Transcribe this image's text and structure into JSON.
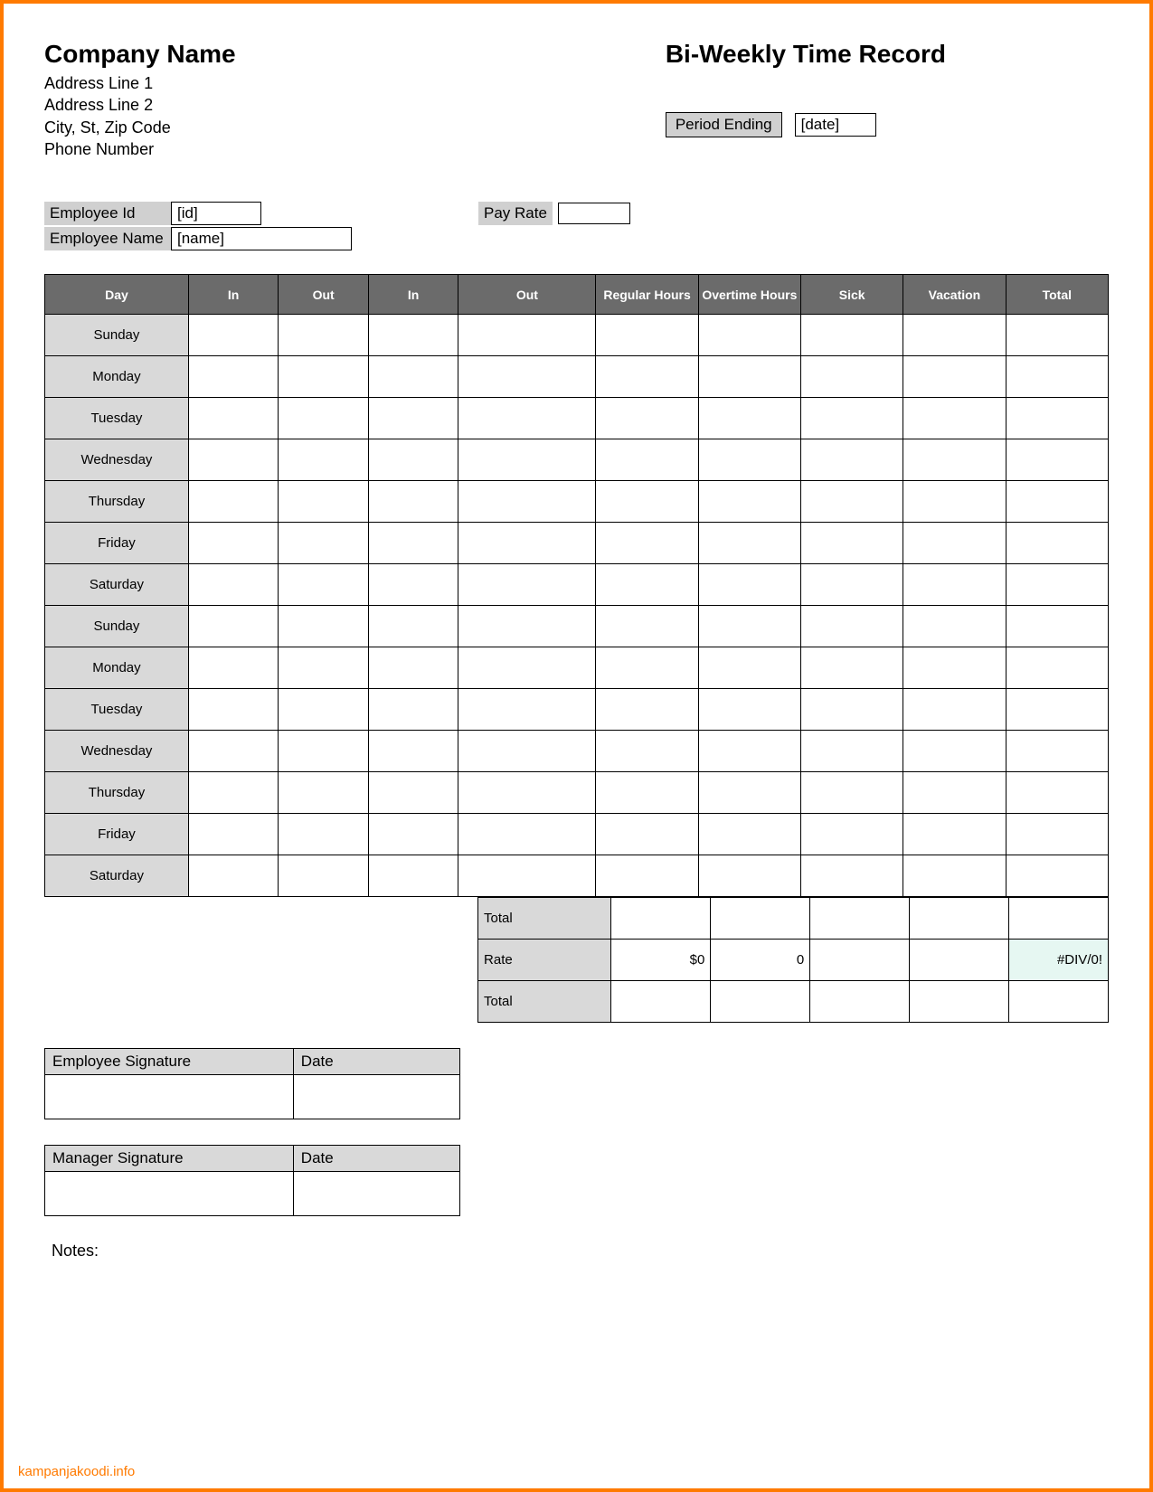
{
  "company": {
    "name": "Company Name",
    "addr1": "Address Line 1",
    "addr2": "Address Line 2",
    "city": "City, St, Zip Code",
    "phone": "Phone Number"
  },
  "doc": {
    "title": "Bi-Weekly Time Record",
    "period_label": "Period Ending",
    "period_value": "[date]"
  },
  "emp": {
    "id_label": "Employee Id",
    "id_value": "[id]",
    "name_label": "Employee Name",
    "name_value": "[name]",
    "payrate_label": "Pay Rate",
    "payrate_value": ""
  },
  "table": {
    "headers": [
      "Day",
      "In",
      "Out",
      "In",
      "Out",
      "Regular Hours",
      "Overtime Hours",
      "Sick",
      "Vacation",
      "Total"
    ],
    "days": [
      "Sunday",
      "Monday",
      "Tuesday",
      "Wednesday",
      "Thursday",
      "Friday",
      "Saturday",
      "Sunday",
      "Monday",
      "Tuesday",
      "Wednesday",
      "Thursday",
      "Friday",
      "Saturday"
    ]
  },
  "totals": {
    "row1_label": "Total",
    "row2_label": "Rate",
    "row2_reg": "$0",
    "row2_ot": "0",
    "row2_total": "#DIV/0!",
    "row3_label": "Total"
  },
  "sig": {
    "emp_label": "Employee Signature",
    "date_label": "Date",
    "mgr_label": "Manager Signature"
  },
  "notes_label": "Notes:",
  "watermark": "kampanjakoodi.info"
}
